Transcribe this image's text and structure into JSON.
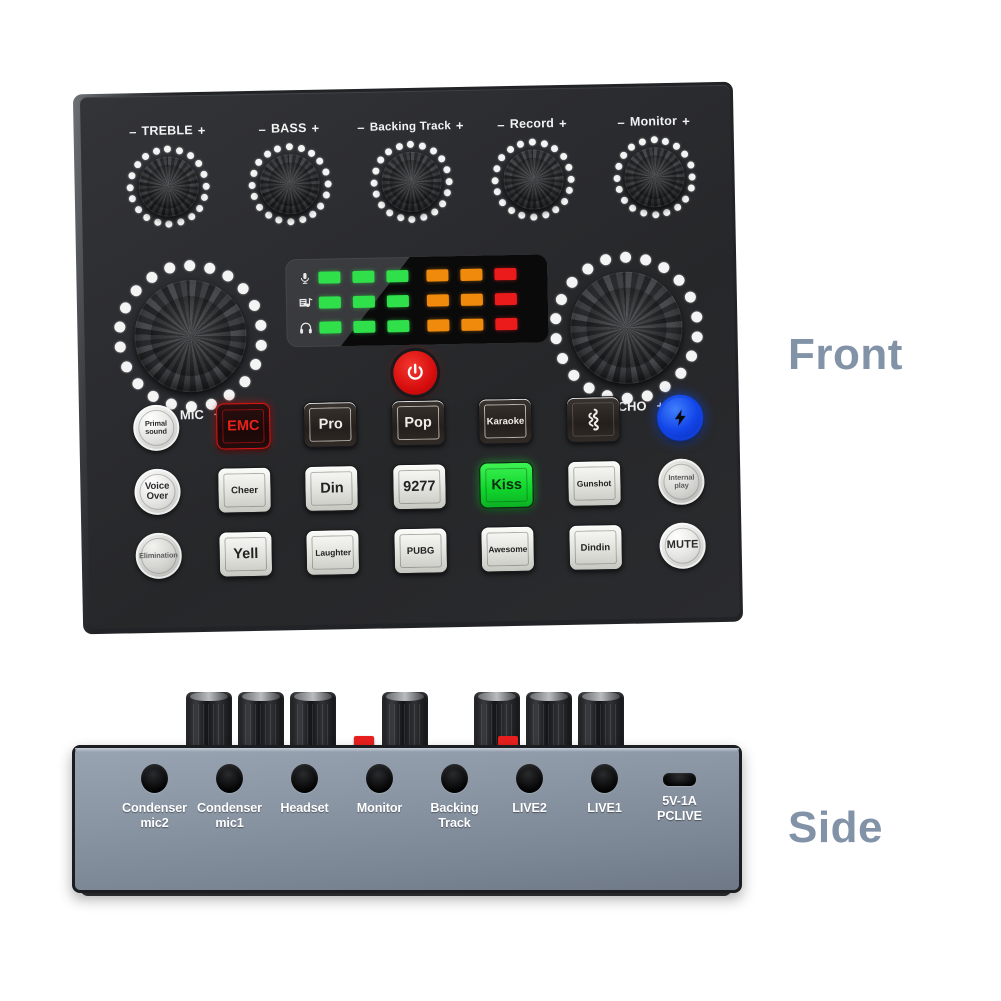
{
  "captions": {
    "front": "Front",
    "side": "Side",
    "color": "#8293a8"
  },
  "front_panel": {
    "top_knobs": [
      {
        "label": "TREBLE",
        "minus": "–",
        "plus": "+",
        "name": "treble"
      },
      {
        "label": "BASS",
        "minus": "–",
        "plus": "+",
        "name": "bass"
      },
      {
        "label": "Backing Track",
        "minus": "–",
        "plus": "+",
        "name": "backing-track"
      },
      {
        "label": "Record",
        "minus": "–",
        "plus": "+",
        "name": "record"
      },
      {
        "label": "Monitor",
        "minus": "–",
        "plus": "+",
        "name": "monitor"
      }
    ],
    "main_knobs": [
      {
        "label": "MIC",
        "minus": "–",
        "plus": "+",
        "name": "mic"
      },
      {
        "label": "ECHO",
        "minus": "–",
        "plus": "+",
        "name": "echo"
      }
    ],
    "led_display": {
      "rows": [
        {
          "icon": "microphone-icon",
          "leds": [
            "green",
            "green",
            "green",
            "orange",
            "orange",
            "red"
          ]
        },
        {
          "icon": "music-sheet-icon",
          "leds": [
            "green",
            "green",
            "green",
            "orange",
            "orange",
            "red"
          ]
        },
        {
          "icon": "headphones-icon",
          "leds": [
            "green",
            "green",
            "green",
            "orange",
            "orange",
            "red"
          ]
        }
      ],
      "colors": {
        "green": "#2fe04a",
        "orange": "#f08a0c",
        "red": "#ec1b1b"
      }
    },
    "power_button": {
      "name": "power-button",
      "color": "#e01414"
    },
    "button_grid": [
      [
        {
          "type": "round",
          "label": "Primal\nsound",
          "name": "primal-sound-button",
          "size": "t8"
        },
        {
          "type": "square",
          "label": "EMC",
          "name": "emc-button",
          "style": "red"
        },
        {
          "type": "square",
          "label": "Pro",
          "name": "pro-button",
          "style": "dark"
        },
        {
          "type": "square",
          "label": "Pop",
          "name": "pop-button",
          "style": "dark"
        },
        {
          "type": "square",
          "label": "Karaoke",
          "name": "karaoke-button",
          "style": "dark",
          "size": "sm"
        },
        {
          "type": "icon",
          "label": "",
          "name": "sound-effect-icon-button",
          "style": "icon"
        },
        {
          "type": "blue",
          "label": "",
          "name": "lightning-effect-button"
        }
      ],
      [
        {
          "type": "round",
          "label": "Voice\nOver",
          "name": "voice-over-button",
          "size": "t10"
        },
        {
          "type": "square",
          "label": "Cheer",
          "name": "cheer-button",
          "style": "light",
          "size": "sm"
        },
        {
          "type": "square",
          "label": "Din",
          "name": "din-button",
          "style": "light"
        },
        {
          "type": "square",
          "label": "9277",
          "name": "9277-button",
          "style": "light"
        },
        {
          "type": "square",
          "label": "Kiss",
          "name": "kiss-button",
          "style": "green"
        },
        {
          "type": "square",
          "label": "Gunshot",
          "name": "gunshot-button",
          "style": "light",
          "size": "xs"
        },
        {
          "type": "round",
          "label": "Internal\nplay",
          "name": "internal-play-button",
          "size": "t8",
          "dim": true
        }
      ],
      [
        {
          "type": "round",
          "label": "Elimination",
          "name": "elimination-button",
          "size": "t8",
          "dim": true
        },
        {
          "type": "square",
          "label": "Yell",
          "name": "yell-button",
          "style": "light"
        },
        {
          "type": "square",
          "label": "Laughter",
          "name": "laughter-button",
          "style": "light",
          "size": "xs"
        },
        {
          "type": "square",
          "label": "PUBG",
          "name": "pubg-button",
          "style": "light",
          "size": "sm"
        },
        {
          "type": "square",
          "label": "Awesome",
          "name": "awesome-button",
          "style": "light",
          "size": "xs"
        },
        {
          "type": "square",
          "label": "Dindin",
          "name": "dindin-button",
          "style": "light",
          "size": "sm"
        },
        {
          "type": "round",
          "label": "MUTE",
          "name": "mute-button",
          "size": "t11"
        }
      ]
    ]
  },
  "side_panel": {
    "knob_count": 7,
    "red_markers": 2,
    "ports": [
      {
        "label": "Condenser\nmic2",
        "type": "jack",
        "name": "condenser-mic2-port"
      },
      {
        "label": "Condenser\nmic1",
        "type": "jack",
        "name": "condenser-mic1-port"
      },
      {
        "label": "Headset",
        "type": "jack",
        "name": "headset-port"
      },
      {
        "label": "Monitor",
        "type": "jack",
        "name": "monitor-port"
      },
      {
        "label": "Backing\nTrack",
        "type": "jack",
        "name": "backing-track-port"
      },
      {
        "label": "LIVE2",
        "type": "jack",
        "name": "live2-port"
      },
      {
        "label": "LIVE1",
        "type": "jack",
        "name": "live1-port"
      },
      {
        "label": "5V-1A\nPCLIVE",
        "type": "usb",
        "name": "usb-power-port"
      }
    ],
    "body_color": "#8c97a6"
  }
}
